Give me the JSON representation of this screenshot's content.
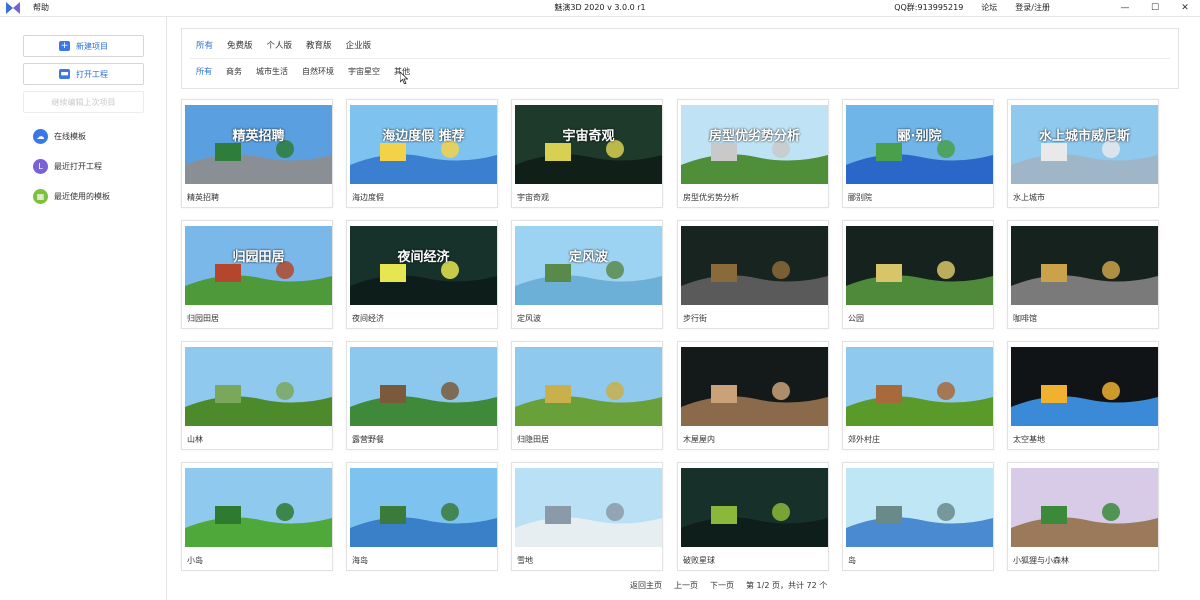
{
  "titlebar": {
    "menu_help": "帮助",
    "title": "魅演3D 2020 v 3.0.0 r1",
    "qq": "QQ群:913995219",
    "forum": "论坛",
    "login": "登录/注册",
    "min_icon": "minimize-icon",
    "max_icon": "maximize-icon",
    "close_icon": "close-icon"
  },
  "sidebar": {
    "new_project": "新建项目",
    "open_project": "打开工程",
    "continue_last": "继续编辑上次项目",
    "items": [
      {
        "label": "在线模板",
        "icon": "cloud-icon",
        "color": "#3b78e7"
      },
      {
        "label": "最近打开工程",
        "icon": "clock-icon",
        "color": "#7b61d6"
      },
      {
        "label": "最近使用的模板",
        "icon": "grid-icon",
        "color": "#7fbf3f"
      }
    ]
  },
  "filters": {
    "editions": [
      "所有",
      "免费版",
      "个人版",
      "教育版",
      "企业版"
    ],
    "categories": [
      "所有",
      "商务",
      "城市生活",
      "自然环境",
      "宇宙星空",
      "其他"
    ],
    "active_edition": "所有",
    "active_category": "所有"
  },
  "templates": [
    {
      "name": "精英招聘",
      "bg": "#5aa0e0",
      "ground": "#8a8f96",
      "accent": "#2e7d3a",
      "overlay": "精英招聘"
    },
    {
      "name": "海边度假",
      "bg": "#7ec3f0",
      "ground": "#3a7fd0",
      "accent": "#f3d24a",
      "overlay": "海边度假 推荐"
    },
    {
      "name": "宇宙奇观",
      "bg": "#1e3a2a",
      "ground": "#102018",
      "accent": "#d8d050",
      "overlay": "宇宙奇观"
    },
    {
      "name": "房型优劣势分析",
      "bg": "#bfe3f5",
      "ground": "#4f8f3a",
      "accent": "#c9c9c9",
      "overlay": "房型优劣势分析"
    },
    {
      "name": "郦别院",
      "bg": "#6fb5e8",
      "ground": "#2b66c9",
      "accent": "#4aa04a",
      "overlay": "郦·别院"
    },
    {
      "name": "水上城市",
      "bg": "#8fc9ee",
      "ground": "#9fb6c8",
      "accent": "#e9e9e9",
      "overlay": "水上城市威尼斯"
    },
    {
      "name": "归园田居",
      "bg": "#7ab8ea",
      "ground": "#4e9a3a",
      "accent": "#b3462c",
      "overlay": "归园田居"
    },
    {
      "name": "夜间经济",
      "bg": "#17312b",
      "ground": "#0d1d1a",
      "accent": "#e6e650",
      "overlay": "夜间经济"
    },
    {
      "name": "定风波",
      "bg": "#9cd3f3",
      "ground": "#6cb0d8",
      "accent": "#5a8a4a",
      "overlay": "定风波"
    },
    {
      "name": "步行街",
      "bg": "#17241f",
      "ground": "#5a5a5a",
      "accent": "#8b6a3a",
      "overlay": ""
    },
    {
      "name": "公园",
      "bg": "#15221e",
      "ground": "#4f8a3a",
      "accent": "#d7c56a",
      "overlay": ""
    },
    {
      "name": "咖啡馆",
      "bg": "#15221e",
      "ground": "#7a7a7a",
      "accent": "#c9a24a",
      "overlay": ""
    },
    {
      "name": "山林",
      "bg": "#8fc9ee",
      "ground": "#4c8a2c",
      "accent": "#7aa85a",
      "overlay": ""
    },
    {
      "name": "露营野餐",
      "bg": "#8cc7ee",
      "ground": "#3f8a3a",
      "accent": "#7a5a3a",
      "overlay": ""
    },
    {
      "name": "归隐田居",
      "bg": "#8fc9ee",
      "ground": "#6aa03a",
      "accent": "#c9b04a",
      "overlay": ""
    },
    {
      "name": "木屋屋内",
      "bg": "#141a1a",
      "ground": "#8a6a4a",
      "accent": "#c9a27a",
      "overlay": ""
    },
    {
      "name": "郊外村庄",
      "bg": "#8fc9ee",
      "ground": "#5a9a2a",
      "accent": "#a86a3a",
      "overlay": ""
    },
    {
      "name": "太空基地",
      "bg": "#101416",
      "ground": "#3a8ad8",
      "accent": "#f0b030",
      "overlay": ""
    },
    {
      "name": "小岛",
      "bg": "#8fc9ee",
      "ground": "#4fa83a",
      "accent": "#2e7a2e",
      "overlay": ""
    },
    {
      "name": "海岛",
      "bg": "#7ec3f0",
      "ground": "#3a80c8",
      "accent": "#3a7a3a",
      "overlay": ""
    },
    {
      "name": "雪地",
      "bg": "#b9e0f5",
      "ground": "#e6eef2",
      "accent": "#8a9aa8",
      "overlay": ""
    },
    {
      "name": "破败星球",
      "bg": "#18302a",
      "ground": "#0e1e1a",
      "accent": "#8ab83a",
      "overlay": ""
    },
    {
      "name": "岛",
      "bg": "#bfe6f5",
      "ground": "#4a8ad0",
      "accent": "#6a8a8a",
      "overlay": ""
    },
    {
      "name": "小狐狸与小森林",
      "bg": "#d8cbe8",
      "ground": "#9a7a5a",
      "accent": "#3a8a3a",
      "overlay": ""
    }
  ],
  "pager": {
    "home": "返回主页",
    "prev": "上一页",
    "next": "下一页",
    "info": "第 1/2 页，共计 72 个"
  }
}
